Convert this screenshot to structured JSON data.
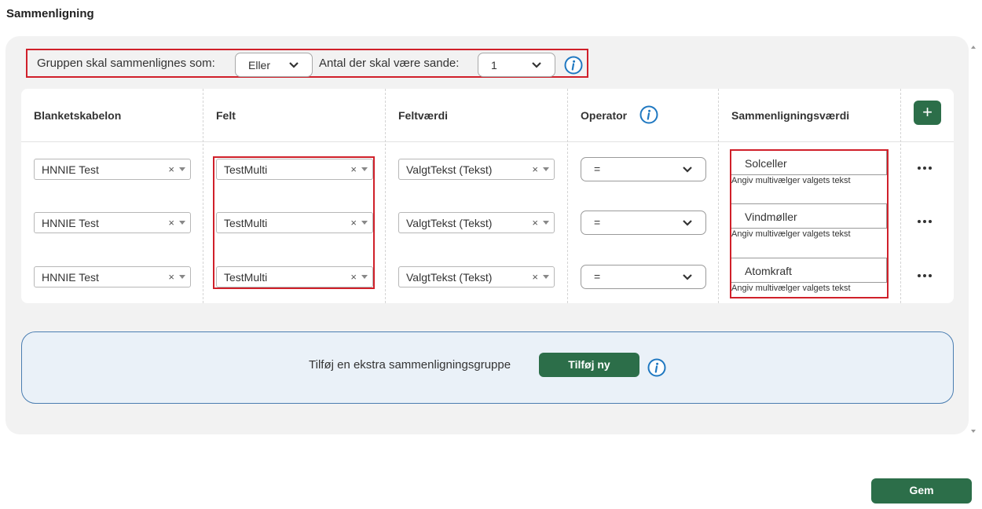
{
  "page": {
    "title": "Sammenligning"
  },
  "group_bar": {
    "compare_label": "Gruppen skal sammenlignes som:",
    "compare_value": "Eller",
    "count_label": "Antal der skal være sande:",
    "count_value": "1"
  },
  "table": {
    "headers": [
      "Blanketskabelon",
      "Felt",
      "Feltværdi",
      "Operator",
      "Sammenligningsværdi"
    ],
    "add_row_label": "+",
    "rows": [
      {
        "template": "HNNIE Test",
        "field": "TestMulti",
        "field_value": "ValgtTekst (Tekst)",
        "operator": "=",
        "compare_value": "Solceller",
        "compare_help": "Angiv multivælger valgets tekst"
      },
      {
        "template": "HNNIE Test",
        "field": "TestMulti",
        "field_value": "ValgtTekst (Tekst)",
        "operator": "=",
        "compare_value": "Vindmøller",
        "compare_help": "Angiv multivælger valgets tekst"
      },
      {
        "template": "HNNIE Test",
        "field": "TestMulti",
        "field_value": "ValgtTekst (Tekst)",
        "operator": "=",
        "compare_value": "Atomkraft",
        "compare_help": "Angiv multivælger valgets tekst"
      }
    ],
    "clear_glyph": "×"
  },
  "extra_group": {
    "label": "Tilføj en ekstra sammenligningsgruppe",
    "button_label": "Tilføj ny"
  },
  "footer": {
    "save_label": "Gem"
  },
  "colors": {
    "primary_button": "#2c6e49",
    "highlight_border": "#d0202a",
    "info_icon": "#1f78c1",
    "extra_group_bg": "#eaf1f8"
  },
  "icons": [
    "chevron-down-icon",
    "info-icon",
    "plus-icon",
    "clear-icon",
    "dropdown-arrow-icon",
    "more-options-icon"
  ]
}
